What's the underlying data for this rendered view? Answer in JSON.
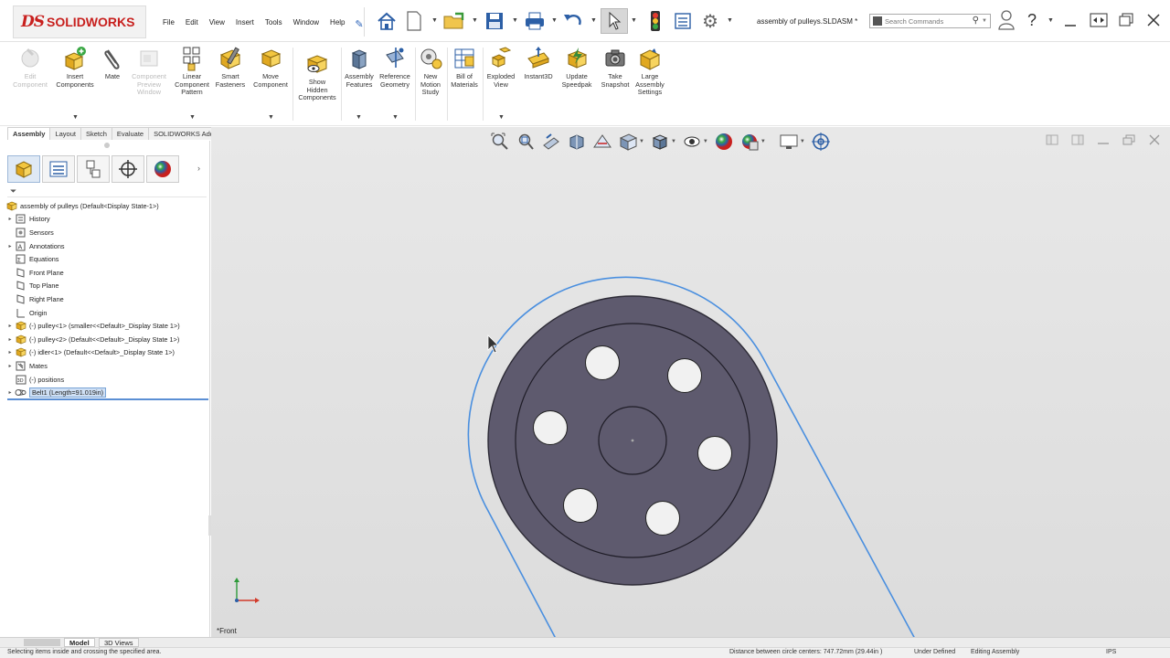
{
  "app": {
    "brand_ds": "DS",
    "brand_name": "SOLIDWORKS",
    "document_title": "assembly of pulleys.SLDASM *"
  },
  "menu": [
    "File",
    "Edit",
    "View",
    "Insert",
    "Tools",
    "Window",
    "Help"
  ],
  "search": {
    "placeholder": "Search Commands"
  },
  "ribbon": {
    "buttons": [
      {
        "label": "Edit\nComponent",
        "icon": "edit-component-icon",
        "enabled": false
      },
      {
        "label": "Insert\nComponents",
        "icon": "insert-components-icon",
        "enabled": true
      },
      {
        "label": "Mate",
        "icon": "mate-paperclip-icon",
        "enabled": true
      },
      {
        "label": "Component\nPreview\nWindow",
        "icon": "component-preview-icon",
        "enabled": false
      },
      {
        "label": "Linear\nComponent\nPattern",
        "icon": "linear-pattern-icon",
        "enabled": true
      },
      {
        "label": "Smart\nFasteners",
        "icon": "smart-fasteners-icon",
        "enabled": true
      },
      {
        "label": "Move\nComponent",
        "icon": "move-component-icon",
        "enabled": true
      },
      {
        "label": "Show\nHidden\nComponents",
        "icon": "show-hidden-icon",
        "enabled": true
      },
      {
        "label": "Assembly\nFeatures",
        "icon": "assembly-features-icon",
        "enabled": true
      },
      {
        "label": "Reference\nGeometry",
        "icon": "reference-geometry-icon",
        "enabled": true
      },
      {
        "label": "New\nMotion\nStudy",
        "icon": "motion-study-icon",
        "enabled": true
      },
      {
        "label": "Bill of\nMaterials",
        "icon": "bill-of-materials-icon",
        "enabled": true
      },
      {
        "label": "Exploded\nView",
        "icon": "exploded-view-icon",
        "enabled": true
      },
      {
        "label": "Instant3D",
        "icon": "instant3d-icon",
        "enabled": true
      },
      {
        "label": "Update\nSpeedpak",
        "icon": "speedpak-icon",
        "enabled": true
      },
      {
        "label": "Take\nSnapshot",
        "icon": "snapshot-camera-icon",
        "enabled": true
      },
      {
        "label": "Large\nAssembly\nSettings",
        "icon": "large-assembly-icon",
        "enabled": true
      }
    ]
  },
  "tabs": [
    {
      "label": "Assembly",
      "active": true
    },
    {
      "label": "Layout",
      "active": false
    },
    {
      "label": "Sketch",
      "active": false
    },
    {
      "label": "Evaluate",
      "active": false
    },
    {
      "label": "SOLIDWORKS Add-Ins",
      "active": false
    }
  ],
  "tree": {
    "root": "assembly of pulleys  (Default<Display State-1>)",
    "items": [
      {
        "label": "History",
        "expand": true,
        "icon": "history-icon"
      },
      {
        "label": "Sensors",
        "expand": false,
        "icon": "sensors-icon"
      },
      {
        "label": "Annotations",
        "expand": true,
        "icon": "annotations-icon"
      },
      {
        "label": "Equations",
        "expand": false,
        "icon": "equations-icon"
      },
      {
        "label": "Front Plane",
        "expand": false,
        "icon": "plane-icon"
      },
      {
        "label": "Top Plane",
        "expand": false,
        "icon": "plane-icon"
      },
      {
        "label": "Right Plane",
        "expand": false,
        "icon": "plane-icon"
      },
      {
        "label": "Origin",
        "expand": false,
        "icon": "origin-icon"
      },
      {
        "label": "(-) pulley<1> (smaller<<Default>_Display State 1>)",
        "expand": true,
        "icon": "part-icon"
      },
      {
        "label": "(-) pulley<2> (Default<<Default>_Display State 1>)",
        "expand": true,
        "icon": "part-icon"
      },
      {
        "label": "(-) idler<1> (Default<<Default>_Display State 1>)",
        "expand": true,
        "icon": "part-icon"
      },
      {
        "label": "Mates",
        "expand": true,
        "icon": "mates-icon"
      },
      {
        "label": "(-) positions",
        "expand": false,
        "icon": "sketch-3d-icon"
      },
      {
        "label": "Belt1 (Length=91.019in)",
        "expand": true,
        "icon": "belt-icon",
        "selected": true
      }
    ]
  },
  "viewport": {
    "view_name": "*Front"
  },
  "bottom_tabs": [
    {
      "label": "Model",
      "active": true
    },
    {
      "label": "3D Views",
      "active": false
    }
  ],
  "status": {
    "message": "Selecting items inside and crossing the specified area.",
    "measure": "Distance between circle centers: 747.72mm (29.44in )",
    "definition": "Under Defined",
    "mode": "Editing Assembly",
    "units": "IPS"
  },
  "colors": {
    "brand_red": "#c8201e",
    "pulley_fill": "#5e5a6e",
    "belt_blue": "#4a8fdf",
    "viewport_bg": "#e2e2e2"
  }
}
